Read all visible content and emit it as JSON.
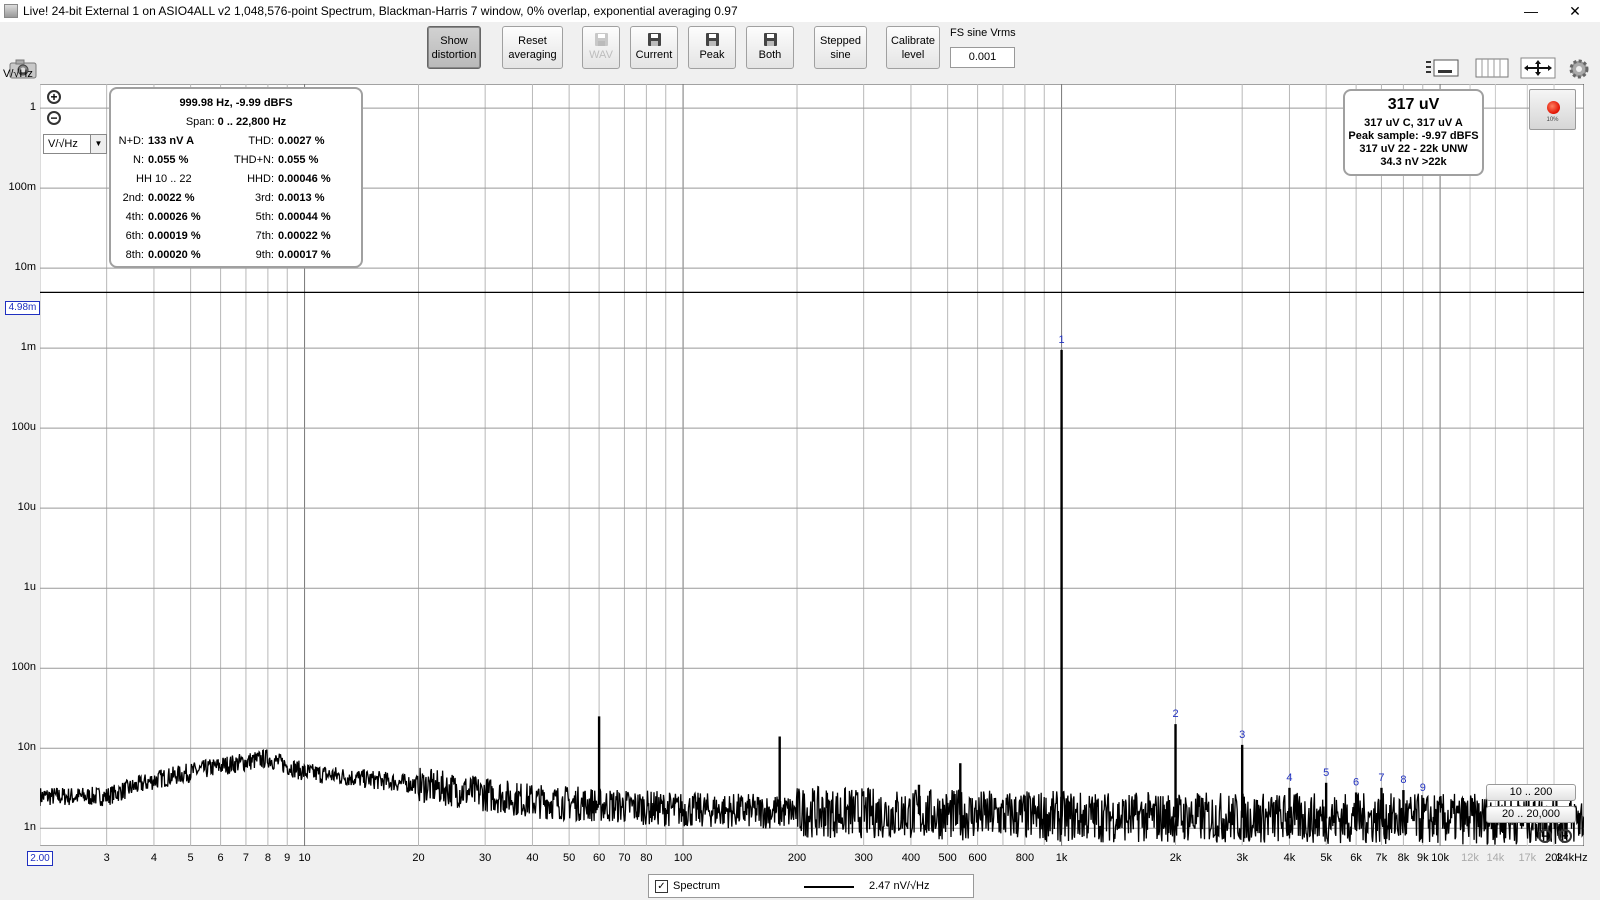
{
  "window": {
    "title": "Live! 24-bit External 1 on ASIO4ALL v2 1,048,576-point Spectrum, Blackman-Harris 7 window, 0% overlap, exponential averaging 0.97",
    "minimize": "—",
    "restore": "❐",
    "close": "✕"
  },
  "toolbar": {
    "show_distortion": [
      "Show",
      "distortion"
    ],
    "reset_averaging": [
      "Reset",
      "averaging"
    ],
    "wav": "WAV",
    "current": "Current",
    "peak": "Peak",
    "both": "Both",
    "stepped_sine": [
      "Stepped",
      "sine"
    ],
    "calibrate_level": [
      "Calibrate",
      "level"
    ],
    "fs_label": "FS sine Vrms",
    "fs_value": "0.001"
  },
  "plot": {
    "y_unit_top": "V/√Hz",
    "unit_select": "V/√Hz",
    "marker_level_label": "4.98m",
    "x_start": "2.00",
    "y_ticks": [
      "1",
      "100m",
      "10m",
      "1m",
      "100u",
      "10u",
      "1u",
      "100n",
      "10n",
      "1n"
    ],
    "x_ticks": [
      "3",
      "4",
      "5",
      "6",
      "7",
      "8",
      "9",
      "10",
      "20",
      "30",
      "40",
      "50",
      "60",
      "70",
      "80",
      "100",
      "200",
      "300",
      "400",
      "500",
      "600",
      "800",
      "1k",
      "2k",
      "3k",
      "4k",
      "5k",
      "6k",
      "7k",
      "8k",
      "9k",
      "10k",
      "12k",
      "14k",
      "17k",
      "20k",
      "24kHz"
    ],
    "range_buttons": [
      "10 .. 200",
      "20 .. 20,000"
    ]
  },
  "distortion_panel": {
    "header": "999.98 Hz, -9.99 dBFS",
    "span_label": "Span:",
    "span_value": "0 .. 22,800 Hz",
    "rows": [
      {
        "l1": "N+D:",
        "v1": "133 nV A",
        "l2": "THD:",
        "v2": "0.0027 %"
      },
      {
        "l1": "N:",
        "v1": "0.055 %",
        "l2": "THD+N:",
        "v2": "0.055 %"
      },
      {
        "l1": "HH 10 .. 22",
        "v1": "",
        "l2": "HHD:",
        "v2": "0.00046 %"
      },
      {
        "l1": "2nd:",
        "v1": "0.0022 %",
        "l2": "3rd:",
        "v2": "0.0013 %"
      },
      {
        "l1": "4th:",
        "v1": "0.00026 %",
        "l2": "5th:",
        "v2": "0.00044 %"
      },
      {
        "l1": "6th:",
        "v1": "0.00019 %",
        "l2": "7th:",
        "v2": "0.00022 %"
      },
      {
        "l1": "8th:",
        "v1": "0.00020 %",
        "l2": "9th:",
        "v2": "0.00017 %"
      }
    ]
  },
  "level_panel": {
    "main": "317 uV",
    "line1": "317 uV C, 317 uV A",
    "line2": "Peak sample: -9.97 dBFS",
    "line3": "317 uV 22 - 22k UNW",
    "line4": "34.3 nV >22k"
  },
  "record": {
    "percent": "10%"
  },
  "legend": {
    "check": "✓",
    "name": "Spectrum",
    "value": "2.47 nV/√Hz"
  },
  "chart_data": {
    "type": "line",
    "title": "",
    "xlabel": "",
    "ylabel": "V/√Hz",
    "x_scale": "log",
    "y_scale": "log",
    "xlim": [
      2,
      24000
    ],
    "ylim": [
      6e-10,
      2
    ],
    "grid": true,
    "marker_line": 0.00498,
    "series": [
      {
        "name": "Spectrum",
        "color": "#000000"
      }
    ],
    "peaks": [
      {
        "label": "",
        "x": 60,
        "y": 2.5e-08
      },
      {
        "label": "",
        "x": 180,
        "y": 1.4e-08
      },
      {
        "label": "",
        "x": 420,
        "y": 3.5e-09
      },
      {
        "label": "",
        "x": 540,
        "y": 6.5e-09
      },
      {
        "label": "1",
        "x": 1000,
        "y": 0.00095
      },
      {
        "label": "2",
        "x": 2000,
        "y": 2e-08
      },
      {
        "label": "3",
        "x": 3000,
        "y": 1.1e-08
      },
      {
        "label": "4",
        "x": 4000,
        "y": 3.2e-09
      },
      {
        "label": "5",
        "x": 5000,
        "y": 3.7e-09
      },
      {
        "label": "6",
        "x": 6000,
        "y": 2.8e-09
      },
      {
        "label": "7",
        "x": 7000,
        "y": 3.2e-09
      },
      {
        "label": "8",
        "x": 8000,
        "y": 3e-09
      },
      {
        "label": "9",
        "x": 9000,
        "y": 2.4e-09
      }
    ],
    "noise_floor": [
      {
        "x": 2,
        "y": 2.5e-09
      },
      {
        "x": 3,
        "y": 2.5e-09
      },
      {
        "x": 4,
        "y": 4e-09
      },
      {
        "x": 6,
        "y": 6e-09
      },
      {
        "x": 8,
        "y": 7.5e-09
      },
      {
        "x": 10,
        "y": 5e-09
      },
      {
        "x": 20,
        "y": 3.5e-09
      },
      {
        "x": 40,
        "y": 2.2e-09
      },
      {
        "x": 100,
        "y": 1.7e-09
      },
      {
        "x": 1000,
        "y": 1.4e-09
      },
      {
        "x": 10000,
        "y": 1.3e-09
      },
      {
        "x": 24000,
        "y": 1.3e-09
      }
    ]
  }
}
